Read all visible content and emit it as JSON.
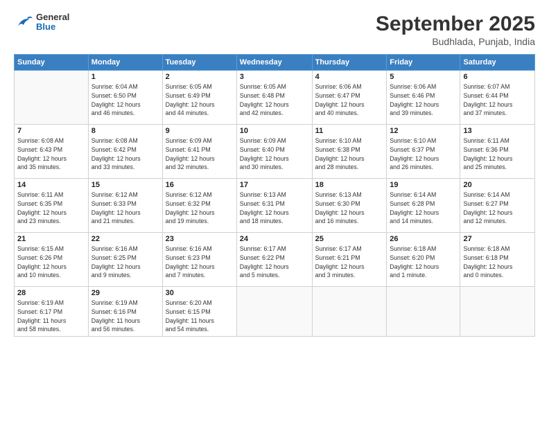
{
  "header": {
    "logo_general": "General",
    "logo_blue": "Blue",
    "month_title": "September 2025",
    "subtitle": "Budhlada, Punjab, India"
  },
  "days_of_week": [
    "Sunday",
    "Monday",
    "Tuesday",
    "Wednesday",
    "Thursday",
    "Friday",
    "Saturday"
  ],
  "weeks": [
    [
      {
        "day": "",
        "info": ""
      },
      {
        "day": "1",
        "info": "Sunrise: 6:04 AM\nSunset: 6:50 PM\nDaylight: 12 hours\nand 46 minutes."
      },
      {
        "day": "2",
        "info": "Sunrise: 6:05 AM\nSunset: 6:49 PM\nDaylight: 12 hours\nand 44 minutes."
      },
      {
        "day": "3",
        "info": "Sunrise: 6:05 AM\nSunset: 6:48 PM\nDaylight: 12 hours\nand 42 minutes."
      },
      {
        "day": "4",
        "info": "Sunrise: 6:06 AM\nSunset: 6:47 PM\nDaylight: 12 hours\nand 40 minutes."
      },
      {
        "day": "5",
        "info": "Sunrise: 6:06 AM\nSunset: 6:46 PM\nDaylight: 12 hours\nand 39 minutes."
      },
      {
        "day": "6",
        "info": "Sunrise: 6:07 AM\nSunset: 6:44 PM\nDaylight: 12 hours\nand 37 minutes."
      }
    ],
    [
      {
        "day": "7",
        "info": "Sunrise: 6:08 AM\nSunset: 6:43 PM\nDaylight: 12 hours\nand 35 minutes."
      },
      {
        "day": "8",
        "info": "Sunrise: 6:08 AM\nSunset: 6:42 PM\nDaylight: 12 hours\nand 33 minutes."
      },
      {
        "day": "9",
        "info": "Sunrise: 6:09 AM\nSunset: 6:41 PM\nDaylight: 12 hours\nand 32 minutes."
      },
      {
        "day": "10",
        "info": "Sunrise: 6:09 AM\nSunset: 6:40 PM\nDaylight: 12 hours\nand 30 minutes."
      },
      {
        "day": "11",
        "info": "Sunrise: 6:10 AM\nSunset: 6:38 PM\nDaylight: 12 hours\nand 28 minutes."
      },
      {
        "day": "12",
        "info": "Sunrise: 6:10 AM\nSunset: 6:37 PM\nDaylight: 12 hours\nand 26 minutes."
      },
      {
        "day": "13",
        "info": "Sunrise: 6:11 AM\nSunset: 6:36 PM\nDaylight: 12 hours\nand 25 minutes."
      }
    ],
    [
      {
        "day": "14",
        "info": "Sunrise: 6:11 AM\nSunset: 6:35 PM\nDaylight: 12 hours\nand 23 minutes."
      },
      {
        "day": "15",
        "info": "Sunrise: 6:12 AM\nSunset: 6:33 PM\nDaylight: 12 hours\nand 21 minutes."
      },
      {
        "day": "16",
        "info": "Sunrise: 6:12 AM\nSunset: 6:32 PM\nDaylight: 12 hours\nand 19 minutes."
      },
      {
        "day": "17",
        "info": "Sunrise: 6:13 AM\nSunset: 6:31 PM\nDaylight: 12 hours\nand 18 minutes."
      },
      {
        "day": "18",
        "info": "Sunrise: 6:13 AM\nSunset: 6:30 PM\nDaylight: 12 hours\nand 16 minutes."
      },
      {
        "day": "19",
        "info": "Sunrise: 6:14 AM\nSunset: 6:28 PM\nDaylight: 12 hours\nand 14 minutes."
      },
      {
        "day": "20",
        "info": "Sunrise: 6:14 AM\nSunset: 6:27 PM\nDaylight: 12 hours\nand 12 minutes."
      }
    ],
    [
      {
        "day": "21",
        "info": "Sunrise: 6:15 AM\nSunset: 6:26 PM\nDaylight: 12 hours\nand 10 minutes."
      },
      {
        "day": "22",
        "info": "Sunrise: 6:16 AM\nSunset: 6:25 PM\nDaylight: 12 hours\nand 9 minutes."
      },
      {
        "day": "23",
        "info": "Sunrise: 6:16 AM\nSunset: 6:23 PM\nDaylight: 12 hours\nand 7 minutes."
      },
      {
        "day": "24",
        "info": "Sunrise: 6:17 AM\nSunset: 6:22 PM\nDaylight: 12 hours\nand 5 minutes."
      },
      {
        "day": "25",
        "info": "Sunrise: 6:17 AM\nSunset: 6:21 PM\nDaylight: 12 hours\nand 3 minutes."
      },
      {
        "day": "26",
        "info": "Sunrise: 6:18 AM\nSunset: 6:20 PM\nDaylight: 12 hours\nand 1 minute."
      },
      {
        "day": "27",
        "info": "Sunrise: 6:18 AM\nSunset: 6:18 PM\nDaylight: 12 hours\nand 0 minutes."
      }
    ],
    [
      {
        "day": "28",
        "info": "Sunrise: 6:19 AM\nSunset: 6:17 PM\nDaylight: 11 hours\nand 58 minutes."
      },
      {
        "day": "29",
        "info": "Sunrise: 6:19 AM\nSunset: 6:16 PM\nDaylight: 11 hours\nand 56 minutes."
      },
      {
        "day": "30",
        "info": "Sunrise: 6:20 AM\nSunset: 6:15 PM\nDaylight: 11 hours\nand 54 minutes."
      },
      {
        "day": "",
        "info": ""
      },
      {
        "day": "",
        "info": ""
      },
      {
        "day": "",
        "info": ""
      },
      {
        "day": "",
        "info": ""
      }
    ]
  ]
}
